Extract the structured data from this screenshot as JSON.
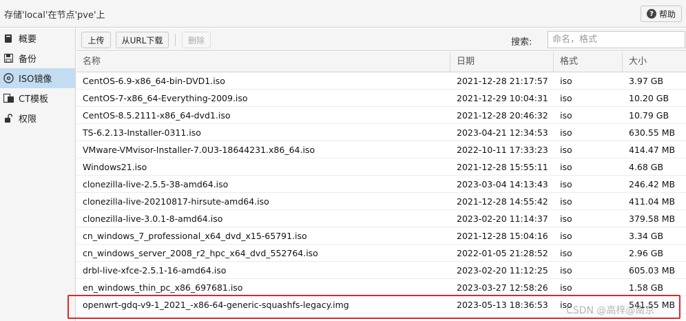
{
  "header": {
    "title": "存储'local'在节点'pve'上",
    "help_label": "帮助"
  },
  "sidebar": {
    "items": [
      {
        "label": "概要",
        "icon": "book-icon"
      },
      {
        "label": "备份",
        "icon": "floppy-icon"
      },
      {
        "label": "ISO镜像",
        "icon": "disc-icon",
        "active": true
      },
      {
        "label": "CT模板",
        "icon": "container-icon"
      },
      {
        "label": "权限",
        "icon": "unlock-icon"
      }
    ]
  },
  "toolbar": {
    "upload_label": "上传",
    "download_url_label": "从URL下载",
    "delete_label": "删除",
    "search_label": "搜索:",
    "search_placeholder": "命名，格式"
  },
  "table": {
    "columns": [
      "名称",
      "日期",
      "格式",
      "大小"
    ],
    "rows": [
      {
        "name": "CentOS-6.9-x86_64-bin-DVD1.iso",
        "date": "2021-12-28 21:17:57",
        "format": "iso",
        "size": "3.97 GB"
      },
      {
        "name": "CentOS-7-x86_64-Everything-2009.iso",
        "date": "2021-12-29 10:04:31",
        "format": "iso",
        "size": "10.20 GB"
      },
      {
        "name": "CentOS-8.5.2111-x86_64-dvd1.iso",
        "date": "2021-12-28 20:46:32",
        "format": "iso",
        "size": "10.79 GB"
      },
      {
        "name": "TS-6.2.13-Installer-0311.iso",
        "date": "2023-04-21 12:34:53",
        "format": "iso",
        "size": "630.55 MB"
      },
      {
        "name": "VMware-VMvisor-Installer-7.0U3-18644231.x86_64.iso",
        "date": "2022-10-11 17:33:23",
        "format": "iso",
        "size": "414.47 MB"
      },
      {
        "name": "Windows21.iso",
        "date": "2021-12-28 15:55:11",
        "format": "iso",
        "size": "4.68 GB"
      },
      {
        "name": "clonezilla-live-2.5.5-38-amd64.iso",
        "date": "2023-03-04 14:13:43",
        "format": "iso",
        "size": "246.42 MB"
      },
      {
        "name": "clonezilla-live-20210817-hirsute-amd64.iso",
        "date": "2021-12-28 14:55:42",
        "format": "iso",
        "size": "411.04 MB"
      },
      {
        "name": "clonezilla-live-3.0.1-8-amd64.iso",
        "date": "2023-02-20 11:14:37",
        "format": "iso",
        "size": "379.58 MB"
      },
      {
        "name": "cn_windows_7_professional_x64_dvd_x15-65791.iso",
        "date": "2021-12-28 15:04:16",
        "format": "iso",
        "size": "3.34 GB"
      },
      {
        "name": "cn_windows_server_2008_r2_hpc_x64_dvd_552764.iso",
        "date": "2022-01-05 21:28:52",
        "format": "iso",
        "size": "2.96 GB"
      },
      {
        "name": "drbl-live-xfce-2.5.1-16-amd64.iso",
        "date": "2023-02-20 11:12:25",
        "format": "iso",
        "size": "605.03 MB"
      },
      {
        "name": "en_windows_thin_pc_x86_697681.iso",
        "date": "2023-03-27 12:58:26",
        "format": "iso",
        "size": "1.58 GB"
      },
      {
        "name": "openwrt-gdq-v9-1_2021_-x86-64-generic-squashfs-legacy.img",
        "date": "2023-05-13 18:36:53",
        "format": "iso",
        "size": "541.55 MB"
      }
    ]
  },
  "watermark": "CSDN @高梓@南京",
  "colors": {
    "highlight_border": "#e0262a",
    "active_sidebar": "#c2ddf2"
  }
}
